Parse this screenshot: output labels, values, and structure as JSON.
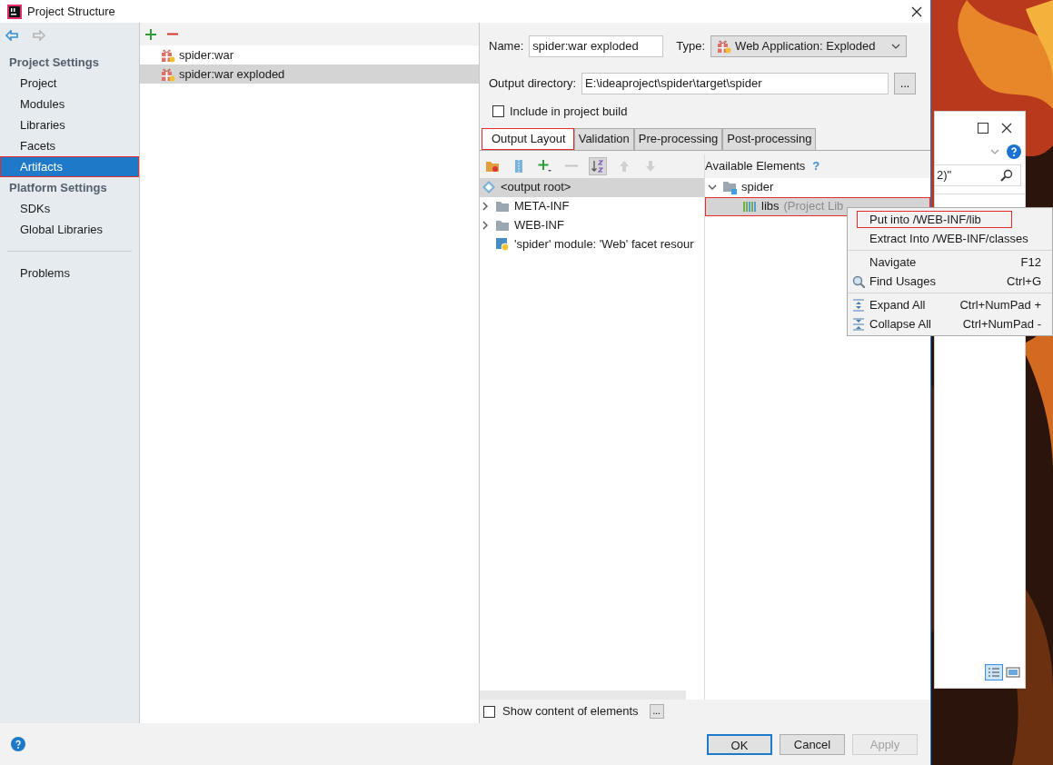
{
  "window": {
    "title": "Project Structure"
  },
  "sidebar": {
    "sections": [
      {
        "title": "Project Settings",
        "items": [
          {
            "label": "Project",
            "selected": false,
            "annotated": false
          },
          {
            "label": "Modules",
            "selected": false,
            "annotated": false
          },
          {
            "label": "Libraries",
            "selected": false,
            "annotated": false
          },
          {
            "label": "Facets",
            "selected": false,
            "annotated": false
          },
          {
            "label": "Artifacts",
            "selected": true,
            "annotated": true
          }
        ]
      },
      {
        "title": "Platform Settings",
        "items": [
          {
            "label": "SDKs",
            "selected": false,
            "annotated": false
          },
          {
            "label": "Global Libraries",
            "selected": false,
            "annotated": false
          }
        ]
      }
    ],
    "footer_items": [
      {
        "label": "Problems",
        "selected": false,
        "annotated": false
      }
    ]
  },
  "artifacts": [
    {
      "label": "spider:war",
      "selected": false
    },
    {
      "label": "spider:war exploded",
      "selected": true
    }
  ],
  "form": {
    "name_label": "Name:",
    "name_value": "spider:war exploded",
    "type_label": "Type:",
    "type_value": "Web Application: Exploded",
    "output_label": "Output directory:",
    "output_value": "E:\\ideaproject\\spider\\target\\spider",
    "browse": "...",
    "include_build": {
      "label": "Include in project build",
      "checked": false
    }
  },
  "tabs": [
    {
      "label": "Output Layout",
      "selected": true,
      "annotated": true
    },
    {
      "label": "Validation",
      "selected": false,
      "annotated": false
    },
    {
      "label": "Pre-processing",
      "selected": false,
      "annotated": false
    },
    {
      "label": "Post-processing",
      "selected": false,
      "annotated": false
    }
  ],
  "layout_toolbar": [
    {
      "kind": "new-dir",
      "disabled": false,
      "pressed": false
    },
    {
      "kind": "archive",
      "disabled": false,
      "pressed": false
    },
    {
      "kind": "add",
      "disabled": false,
      "pressed": false
    },
    {
      "kind": "remove",
      "disabled": true,
      "pressed": false
    },
    {
      "kind": "sort",
      "disabled": false,
      "pressed": true
    },
    {
      "kind": "up",
      "disabled": true,
      "pressed": false
    },
    {
      "kind": "down",
      "disabled": true,
      "pressed": false
    }
  ],
  "layout_tree": [
    {
      "label": "<output root>",
      "kind": "root",
      "selected": true
    },
    {
      "label": "META-INF",
      "kind": "folder",
      "selected": false,
      "expanded": false
    },
    {
      "label": "WEB-INF",
      "kind": "folder",
      "selected": false,
      "expanded": false
    },
    {
      "label": "'spider' module: 'Web' facet resour",
      "kind": "module",
      "selected": false
    }
  ],
  "available": {
    "title": "Available Elements",
    "help": "?",
    "tree": [
      {
        "label": "spider",
        "kind": "module-folder",
        "selected": false,
        "expanded": true,
        "annotated": false,
        "children": [
          {
            "label": "libs",
            "note": "(Project Lib",
            "kind": "library",
            "selected": true,
            "annotated": true
          }
        ]
      }
    ]
  },
  "show_content": {
    "label": "Show content of elements",
    "checked": false,
    "browse": "..."
  },
  "buttons": [
    {
      "label": "OK",
      "default": true,
      "disabled": false
    },
    {
      "label": "Cancel",
      "default": false,
      "disabled": false
    },
    {
      "label": "Apply",
      "default": false,
      "disabled": true
    }
  ],
  "context_menu": {
    "groups": [
      [
        {
          "label": "Put into /WEB-INF/lib",
          "kind": "plain",
          "annotated": true
        },
        {
          "label": "Extract Into /WEB-INF/classes",
          "kind": "plain",
          "annotated": false
        }
      ],
      [
        {
          "label": "Navigate",
          "shortcut": "F12",
          "kind": "plain",
          "annotated": false
        },
        {
          "label": "Find Usages",
          "shortcut": "Ctrl+G",
          "kind": "find",
          "annotated": false
        }
      ],
      [
        {
          "label": "Expand All",
          "shortcut": "Ctrl+NumPad +",
          "kind": "expand",
          "annotated": false
        },
        {
          "label": "Collapse All",
          "shortcut": "Ctrl+NumPad -",
          "kind": "collapse",
          "annotated": false
        }
      ]
    ]
  },
  "background_window": {
    "search_text": "2)\""
  }
}
